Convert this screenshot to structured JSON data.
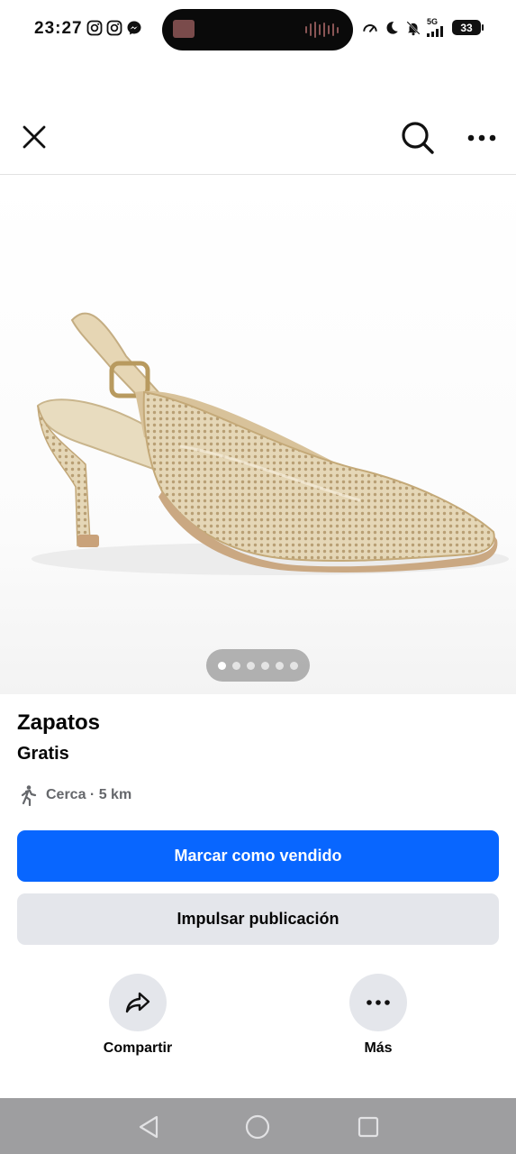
{
  "status_bar": {
    "time": "23:27",
    "network": "5G",
    "battery": "33",
    "left_icons": [
      "instagram-icon",
      "instagram-icon",
      "messenger-icon"
    ],
    "right_icons": [
      "speed-icon",
      "moon-icon",
      "mute-icon",
      "signal-icon",
      "battery-icon"
    ]
  },
  "app_bar": {
    "icons": [
      "close-icon",
      "search-icon",
      "more-icon"
    ]
  },
  "photo": {
    "subject": "gold rhinestone slingback heel",
    "image_count": 6,
    "active_index": 0
  },
  "listing": {
    "title": "Zapatos",
    "price": "Gratis",
    "location": "Cerca · 5 km",
    "location_icon": "walking-person-icon"
  },
  "buttons": {
    "primary": "Marcar como vendido",
    "secondary": "Impulsar publicación"
  },
  "actions": {
    "share_label": "Compartir",
    "more_label": "Más"
  },
  "nav_bar": {
    "icons": [
      "back-icon",
      "home-icon",
      "recents-icon"
    ]
  },
  "colors": {
    "primary": "#0866ff",
    "secondary_bg": "#e4e6eb",
    "muted_text": "#65676b",
    "nav_bar": "#9e9ea0"
  }
}
